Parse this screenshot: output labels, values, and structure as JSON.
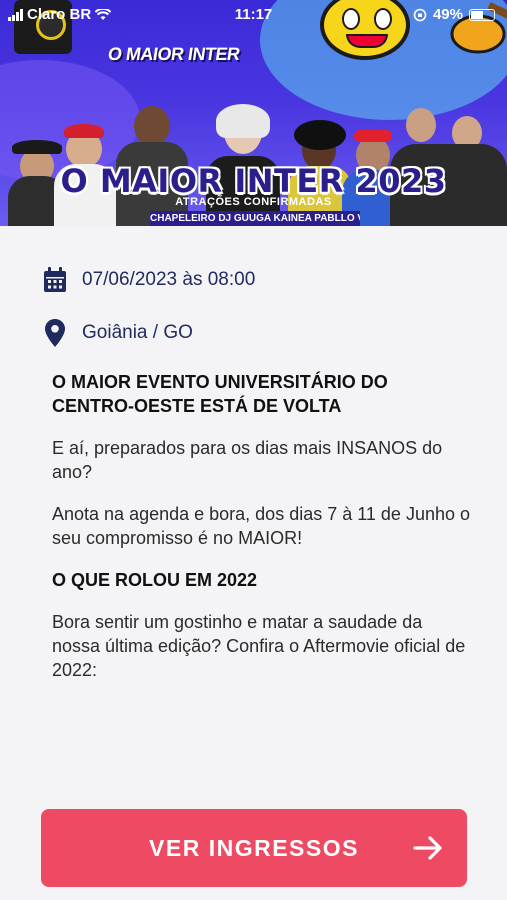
{
  "status_bar": {
    "carrier": "Claro BR",
    "time": "11:17",
    "battery": "49%"
  },
  "banner": {
    "logo": "O MAIOR INTER",
    "title": "O MAIOR INTER 2023",
    "subtitle": "ATRAÇÕES CONFIRMADAS",
    "names": "CHAPELEIRO   DJ GUUGA   KAINEA   PABLLO VITTAR"
  },
  "event": {
    "date_time": "07/06/2023 às 08:00",
    "location": "Goiânia / GO"
  },
  "description": {
    "heading_1": "O MAIOR EVENTO UNIVERSITÁRIO DO CENTRO-OESTE ESTÁ DE VOLTA",
    "paragraph_1": "E aí, preparados para os dias mais INSANOS do ano?",
    "paragraph_2": "Anota na agenda e bora, dos dias 7 à 11 de Junho o seu compromisso é no MAIOR!",
    "heading_2": "O QUE ROLOU EM 2022",
    "paragraph_3": "Bora sentir um gostinho e matar a saudade da nossa última edição? Confira o Aftermovie oficial de 2022:"
  },
  "cta": {
    "label": "VER INGRESSOS"
  },
  "colors": {
    "accent": "#ee4a63",
    "icon": "#1f2a5e",
    "banner": "#3a2ad6"
  }
}
